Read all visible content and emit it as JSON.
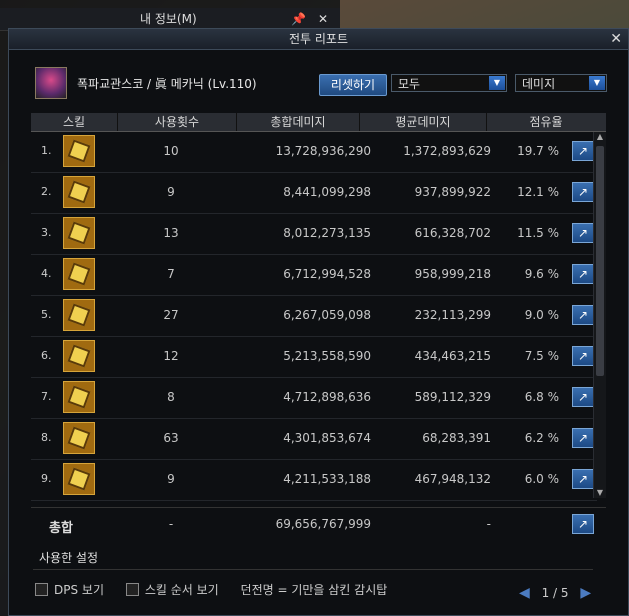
{
  "bg_window": {
    "title": "내 정보(M)"
  },
  "dialog": {
    "title": "전투 리포트"
  },
  "header": {
    "character": "폭파교관스코 / 眞 메카닉 (Lv.110)",
    "reset_label": "리셋하기",
    "filter_select": "모두",
    "metric_select": "데미지"
  },
  "table": {
    "columns": [
      "스킬",
      "사용횟수",
      "총합데미지",
      "평균데미지",
      "점유율"
    ],
    "rows": [
      {
        "rank": "1.",
        "count": "10",
        "total": "13,728,936,290",
        "avg": "1,372,893,629",
        "share": "19.7 %"
      },
      {
        "rank": "2.",
        "count": "9",
        "total": "8,441,099,298",
        "avg": "937,899,922",
        "share": "12.1 %"
      },
      {
        "rank": "3.",
        "count": "13",
        "total": "8,012,273,135",
        "avg": "616,328,702",
        "share": "11.5 %"
      },
      {
        "rank": "4.",
        "count": "7",
        "total": "6,712,994,528",
        "avg": "958,999,218",
        "share": "9.6 %"
      },
      {
        "rank": "5.",
        "count": "27",
        "total": "6,267,059,098",
        "avg": "232,113,299",
        "share": "9.0 %"
      },
      {
        "rank": "6.",
        "count": "12",
        "total": "5,213,558,590",
        "avg": "434,463,215",
        "share": "7.5 %"
      },
      {
        "rank": "7.",
        "count": "8",
        "total": "4,712,898,636",
        "avg": "589,112,329",
        "share": "6.8 %"
      },
      {
        "rank": "8.",
        "count": "63",
        "total": "4,301,853,674",
        "avg": "68,283,391",
        "share": "6.2 %"
      },
      {
        "rank": "9.",
        "count": "9",
        "total": "4,211,533,188",
        "avg": "467,948,132",
        "share": "6.0 %"
      }
    ],
    "total": {
      "label": "총합",
      "count": "-",
      "total": "69,656,767,999",
      "avg": "-"
    }
  },
  "settings_label": "사용한 설정",
  "footer": {
    "dps_label": "DPS 보기",
    "skill_order_label": "스킬 순서 보기",
    "dungeon_text": "던전명 = 기만을 삼킨 감시탑",
    "page": "1 / 5"
  },
  "colors": {
    "accent": "#2f63a8",
    "dialog_bg": "#0d0f12"
  }
}
